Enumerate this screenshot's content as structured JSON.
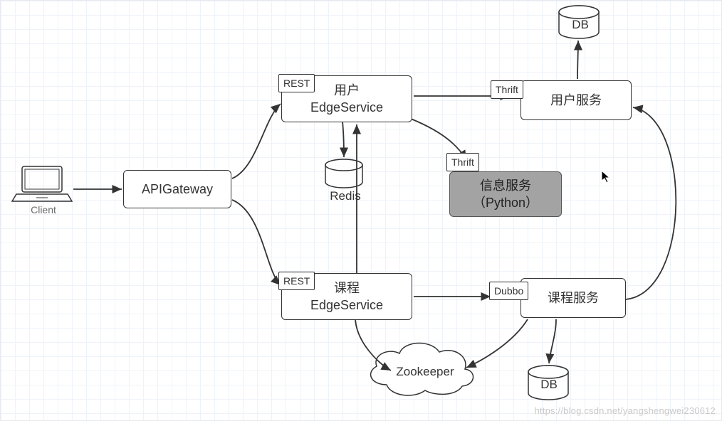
{
  "nodes": {
    "client_label": "Client",
    "api_gateway": "APIGateway",
    "user_edge_service": "用户\nEdgeService",
    "course_edge_service": "课程\nEdgeService",
    "user_service": "用户服务",
    "info_service": "信息服务\n（Python）",
    "course_service": "课程服务",
    "redis_label": "Redis",
    "zookeeper_label": "Zookeeper",
    "db_top_label": "DB",
    "db_bottom_label": "DB"
  },
  "tags": {
    "rest_user": "REST",
    "rest_course": "REST",
    "thrift_user": "Thrift",
    "thrift_info": "Thrift",
    "dubbo": "Dubbo"
  },
  "edges": [
    {
      "from": "client",
      "to": "api_gateway",
      "type": "arrow"
    },
    {
      "from": "api_gateway",
      "to": "user_edge_service",
      "via": "REST",
      "type": "arrow"
    },
    {
      "from": "api_gateway",
      "to": "course_edge_service",
      "via": "REST",
      "type": "arrow"
    },
    {
      "from": "user_edge_service",
      "to": "redis",
      "type": "arrow"
    },
    {
      "from": "user_edge_service",
      "to": "user_service",
      "via": "Thrift",
      "type": "arrow"
    },
    {
      "from": "user_edge_service",
      "to": "info_service",
      "via": "Thrift",
      "type": "arrow"
    },
    {
      "from": "course_edge_service",
      "to": "user_edge_service",
      "type": "arrow"
    },
    {
      "from": "course_edge_service",
      "to": "course_service",
      "via": "Dubbo",
      "type": "arrow"
    },
    {
      "from": "course_edge_service",
      "to": "zookeeper",
      "type": "arrow"
    },
    {
      "from": "course_service",
      "to": "zookeeper",
      "type": "arrow"
    },
    {
      "from": "course_service",
      "to": "db_bottom",
      "type": "arrow"
    },
    {
      "from": "course_service",
      "to": "user_service",
      "type": "arrow"
    },
    {
      "from": "user_service",
      "to": "db_top",
      "type": "arrow"
    }
  ],
  "watermark": "https://blog.csdn.net/yangshengwei230612",
  "colors": {
    "stroke": "#333333",
    "grid": "#eef3f9",
    "gray_fill": "#a3a3a3"
  }
}
